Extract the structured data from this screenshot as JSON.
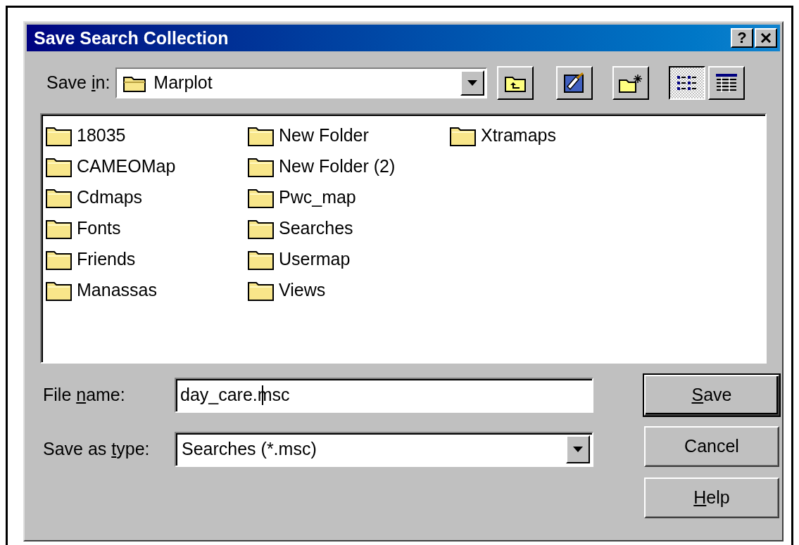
{
  "window": {
    "title": "Save Search Collection",
    "title_buttons": [
      {
        "kind": "help",
        "label": "?"
      },
      {
        "kind": "close"
      }
    ]
  },
  "save_in": {
    "label": {
      "before": "Save ",
      "key": "i",
      "after": "n:"
    },
    "value": "Marplot"
  },
  "toolbar": [
    {
      "kind": "up",
      "selected": false
    },
    {
      "kind": "desktop",
      "selected": false
    },
    {
      "kind": "new-folder",
      "selected": false
    },
    {
      "kind": "list",
      "selected": true
    },
    {
      "kind": "details",
      "selected": false
    }
  ],
  "files": [
    {
      "name": "18035"
    },
    {
      "name": "CAMEOMap"
    },
    {
      "name": "Cdmaps"
    },
    {
      "name": "Fonts"
    },
    {
      "name": "Friends"
    },
    {
      "name": "Manassas"
    },
    {
      "name": "New Folder"
    },
    {
      "name": "New Folder (2)"
    },
    {
      "name": "Pwc_map"
    },
    {
      "name": "Searches"
    },
    {
      "name": "Usermap"
    },
    {
      "name": "Views"
    },
    {
      "name": "Xtramaps"
    }
  ],
  "file_name": {
    "label": {
      "before": "File ",
      "key": "n",
      "after": "ame:"
    },
    "value": "day_care.msc"
  },
  "save_as_type": {
    "label": {
      "before": "Save as ",
      "key": "t",
      "after": "ype:"
    },
    "value": "Searches (*.msc)"
  },
  "buttons": [
    {
      "label": {
        "key": "S",
        "after": "ave"
      },
      "default": true
    },
    {
      "label": {
        "before": "Cancel"
      },
      "default": false
    },
    {
      "label": {
        "key": "H",
        "after": "elp"
      },
      "default": false
    }
  ]
}
